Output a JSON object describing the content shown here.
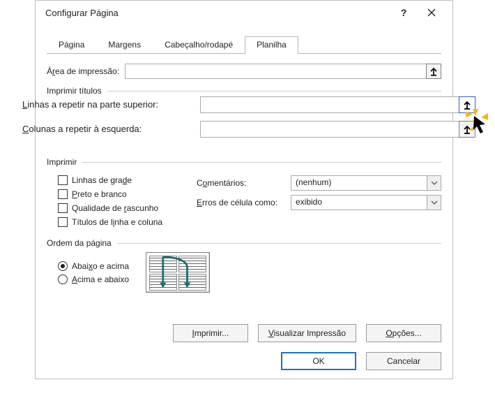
{
  "window": {
    "title": "Configurar Página",
    "help": "?",
    "close_label": "Fechar"
  },
  "tabs": {
    "pagina": "Página",
    "margens": "Margens",
    "cabecalho": "Cabeçalho/rodapé",
    "planilha": "Planilha"
  },
  "fields": {
    "area_impressao_label_prefix": "Á",
    "area_impressao_label_u": "r",
    "area_impressao_label_suffix": "ea de impressão:",
    "area_impressao_value": ""
  },
  "groups": {
    "imprimir_titulos": "Imprimir títulos",
    "imprimir": "Imprimir",
    "ordem_pagina": "Ordem da página"
  },
  "print_titles": {
    "rows_label_u": "L",
    "rows_label_rest": "inhas a repetir na parte superior:",
    "rows_value": "",
    "cols_label_u": "C",
    "cols_label_rest": "olunas a repetir à esquerda:",
    "cols_value": ""
  },
  "print_opts": {
    "gridlines_prefix": "Linhas de gra",
    "gridlines_u": "d",
    "gridlines_suffix": "e",
    "bw_u": "P",
    "bw_rest": "reto e branco",
    "draft_prefix": "Qualidade de ",
    "draft_u": "r",
    "draft_suffix": "ascunho",
    "rc_prefix": "Títulos de l",
    "rc_u": "i",
    "rc_suffix": "nha e coluna",
    "comments_label_prefix": "C",
    "comments_label_u": "o",
    "comments_label_suffix": "mentários:",
    "comments_value": "(nenhum)",
    "errors_label_u": "E",
    "errors_label_rest": "rros de célula como:",
    "errors_value": "exibido"
  },
  "order": {
    "down_prefix": "Abai",
    "down_u": "x",
    "down_suffix": "o e acima",
    "over_u": "A",
    "over_rest": "cima e abaixo"
  },
  "buttons": {
    "print_u": "I",
    "print_rest": "mprimir...",
    "preview_u": "V",
    "preview_rest": "isualizar Impressão",
    "options_u": "O",
    "options_rest": "pções...",
    "ok": "OK",
    "cancel": "Cancelar"
  }
}
